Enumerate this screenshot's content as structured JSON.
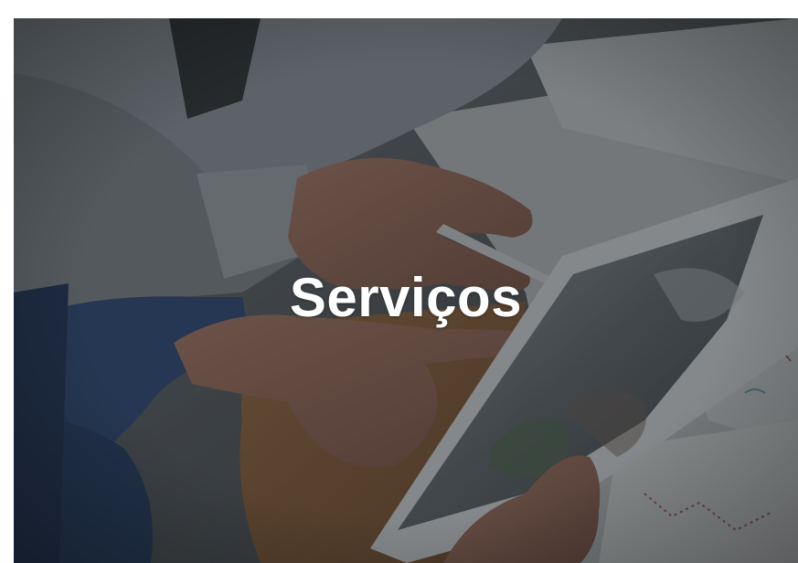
{
  "banner": {
    "title": "Serviços",
    "image_subject": "business-meeting-tablet-photo",
    "overlay_color": "#1a1c20"
  }
}
